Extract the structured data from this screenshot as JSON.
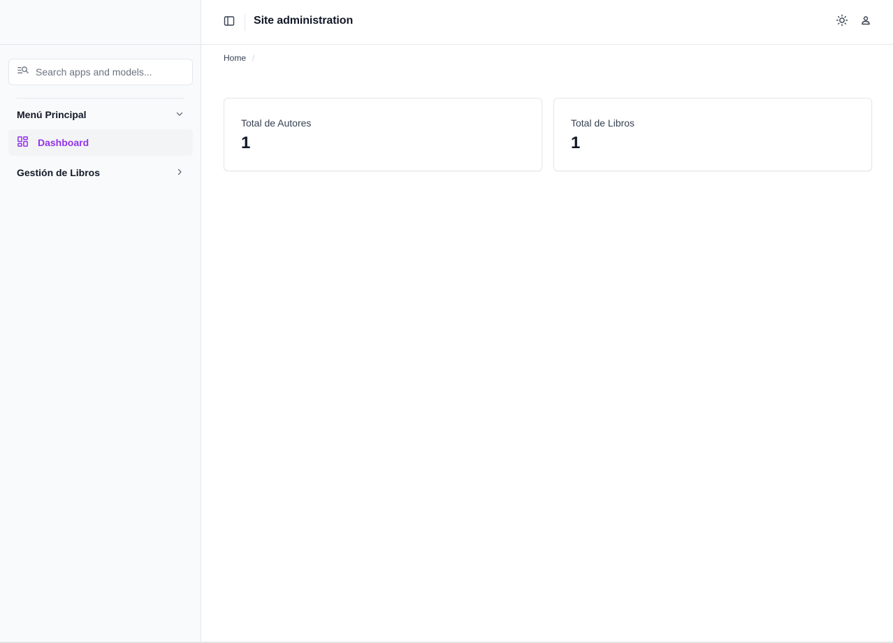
{
  "header": {
    "title": "Site administration"
  },
  "search": {
    "placeholder": "Search apps and models..."
  },
  "sidebar": {
    "groups": [
      {
        "label": "Menú Principal",
        "expanded": true,
        "items": [
          {
            "label": "Dashboard",
            "icon": "dashboard-icon",
            "active": true
          }
        ]
      },
      {
        "label": "Gestión de Libros",
        "expanded": false
      }
    ]
  },
  "breadcrumb": {
    "items": [
      "Home"
    ],
    "separator": "/"
  },
  "cards": [
    {
      "label": "Total de Autores",
      "value": "1"
    },
    {
      "label": "Total de Libros",
      "value": "1"
    }
  ],
  "colors": {
    "accent": "#9333ea",
    "sidebar_bg": "#f9fafb",
    "border": "#e5e7eb",
    "text": "#111827"
  }
}
